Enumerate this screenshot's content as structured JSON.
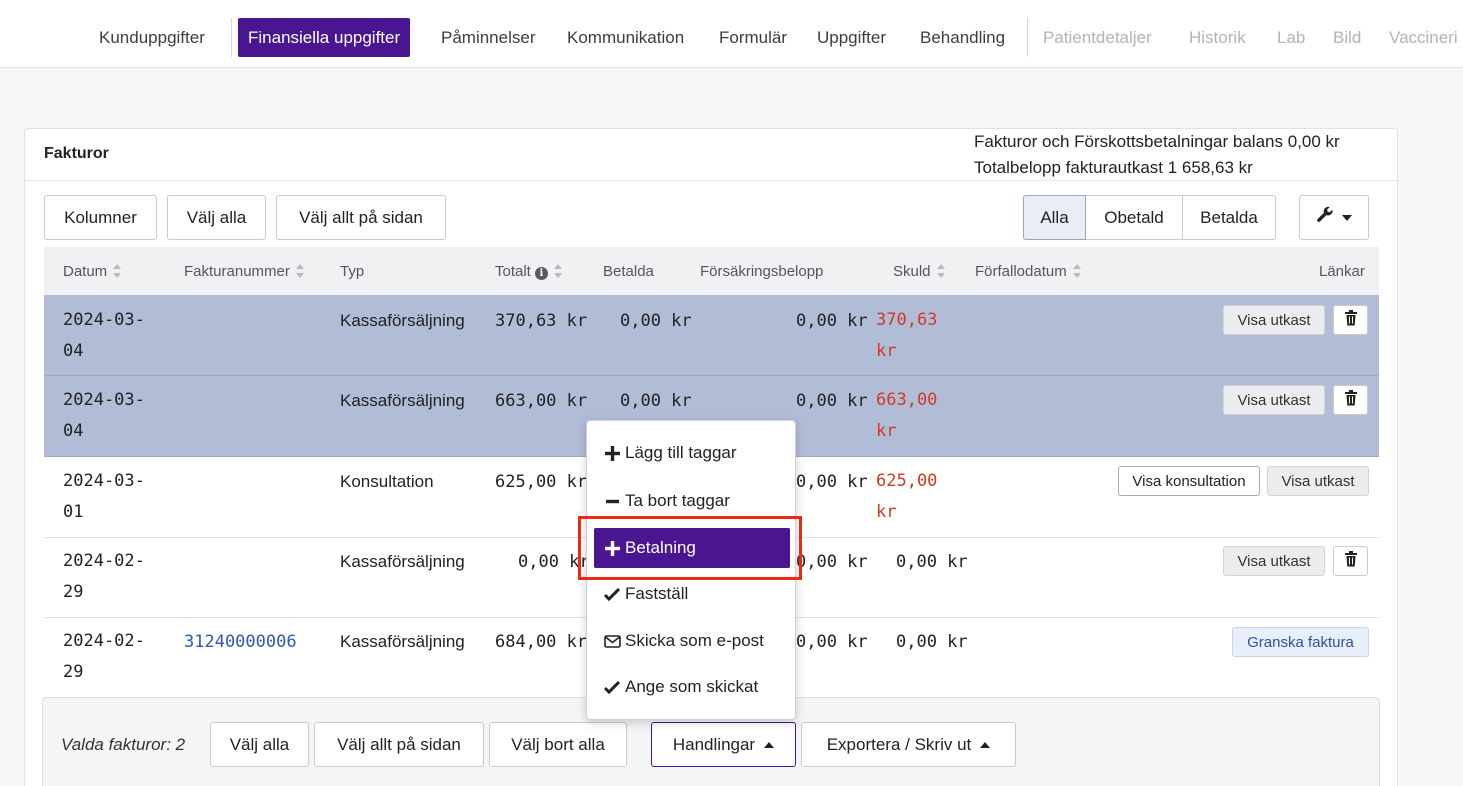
{
  "tabs": [
    {
      "label": "Kunduppgifter",
      "state": "normal"
    },
    {
      "label": "Finansiella uppgifter",
      "state": "active"
    },
    {
      "label": "Påminnelser",
      "state": "normal"
    },
    {
      "label": "Kommunikation",
      "state": "normal"
    },
    {
      "label": "Formulär",
      "state": "normal"
    },
    {
      "label": "Uppgifter",
      "state": "normal"
    },
    {
      "label": "Behandling",
      "state": "normal"
    },
    {
      "label": "Patientdetaljer",
      "state": "disabled"
    },
    {
      "label": "Historik",
      "state": "disabled"
    },
    {
      "label": "Lab",
      "state": "disabled"
    },
    {
      "label": "Bild",
      "state": "disabled"
    },
    {
      "label": "Vaccineri",
      "state": "disabled"
    }
  ],
  "card": {
    "title": "Fakturor",
    "balance_line1": "Fakturor och Förskottsbetalningar balans 0,00 kr",
    "balance_line2": "Totalbelopp fakturautkast 1 658,63 kr"
  },
  "toolbar": {
    "columns": "Kolumner",
    "select_all": "Välj alla",
    "select_page": "Välj allt på sidan",
    "filter_all": "Alla",
    "filter_unpaid": "Obetald",
    "filter_paid": "Betalda",
    "settings_icon": "wrench-icon"
  },
  "table": {
    "headers": {
      "date": "Datum",
      "invoice_no": "Fakturanummer",
      "type": "Typ",
      "total": "Totalt",
      "paid": "Betalda",
      "insurance": "Försäkringsbelopp",
      "debt": "Skuld",
      "due": "Förfallodatum",
      "links": "Länkar"
    },
    "rows": [
      {
        "date": "2024-03-04",
        "invoice": "",
        "type": "Kassaförsäljning",
        "total": "370,63 kr",
        "paid": "0,00 kr",
        "insurance": "0,00 kr",
        "debt": "370,63 kr",
        "link1": "Visa utkast"
      },
      {
        "date": "2024-03-04",
        "invoice": "",
        "type": "Kassaförsäljning",
        "total": "663,00 kr",
        "paid": "0,00 kr",
        "insurance": "0,00 kr",
        "debt": "663,00 kr",
        "link1": "Visa utkast"
      },
      {
        "date": "2024-03-01",
        "invoice": "",
        "type": "Konsultation",
        "total": "625,00 kr",
        "paid": "",
        "insurance": "0,00 kr",
        "debt": "625,00 kr",
        "link1": "Visa konsultation",
        "link2": "Visa utkast"
      },
      {
        "date": "2024-02-29",
        "invoice": "",
        "type": "Kassaförsäljning",
        "total": "0,00 kr",
        "paid": "",
        "insurance": "0,00 kr",
        "debt": "0,00 kr",
        "link1": "Visa utkast"
      },
      {
        "date": "2024-02-29",
        "invoice": "31240000006",
        "type": "Kassaförsäljning",
        "total": "684,00 kr",
        "paid": "",
        "insurance": "0,00 kr",
        "debt": "0,00 kr",
        "link1": "Granska faktura"
      }
    ]
  },
  "dropdown": {
    "items": [
      {
        "label": "Lägg till taggar",
        "icon": "plus-icon"
      },
      {
        "label": "Ta bort taggar",
        "icon": "minus-icon"
      },
      {
        "label": "Betalning",
        "icon": "plus-icon"
      },
      {
        "label": "Fastställ",
        "icon": "check-icon"
      },
      {
        "label": "Skicka som e-post",
        "icon": "envelope-icon"
      },
      {
        "label": "Ange som skickat",
        "icon": "check-icon"
      }
    ]
  },
  "bottombar": {
    "label": "Valda fakturor: 2",
    "select_all": "Välj alla",
    "select_page": "Välj allt på sidan",
    "deselect_all": "Välj bort alla",
    "actions": "Handlingar",
    "export": "Exportera / Skriv ut"
  },
  "colors": {
    "accent": "#4a1591",
    "selected_row": "#b1bcd7",
    "debt": "#d23a22",
    "highlight": "#ee2a10"
  }
}
